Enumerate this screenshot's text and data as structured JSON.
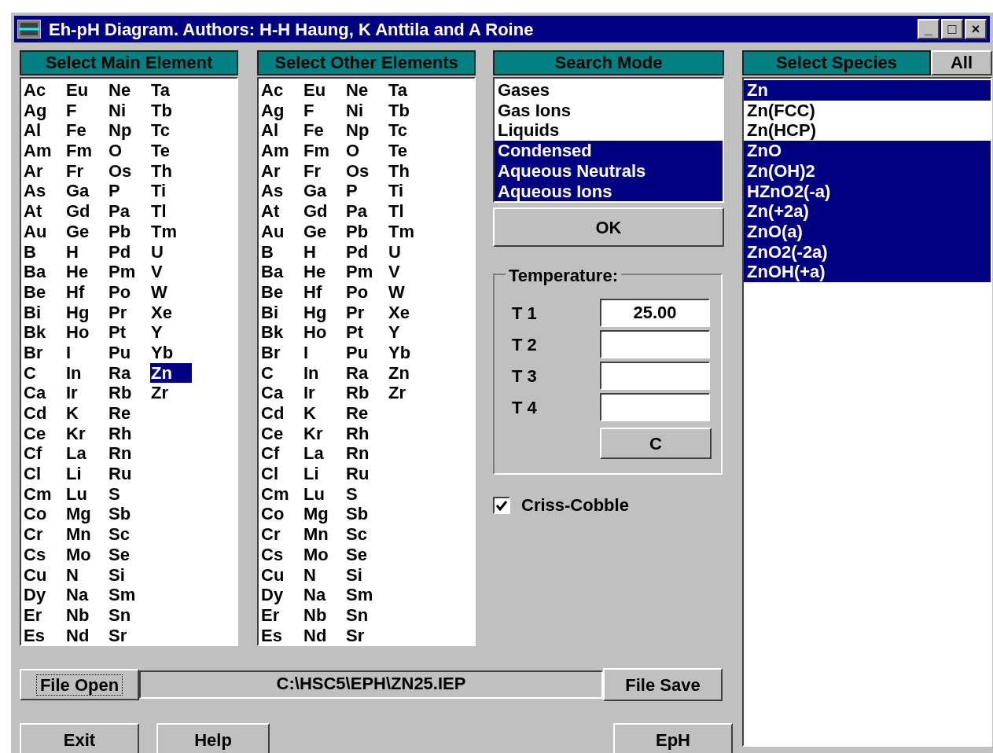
{
  "window": {
    "title": "Eh-pH Diagram. Authors: H-H Haung, K Anttila and A Roine",
    "controls": [
      "_",
      "□",
      "×"
    ]
  },
  "main_element": {
    "title": "Select Main Element",
    "items": [
      {
        "label": "Ac",
        "selected": false
      },
      {
        "label": "Ag",
        "selected": false
      },
      {
        "label": "Al",
        "selected": false
      },
      {
        "label": "Am",
        "selected": false
      },
      {
        "label": "Ar",
        "selected": false
      },
      {
        "label": "As",
        "selected": false
      },
      {
        "label": "At",
        "selected": false
      },
      {
        "label": "Au",
        "selected": false
      },
      {
        "label": "B",
        "selected": false
      },
      {
        "label": "Ba",
        "selected": false
      },
      {
        "label": "Be",
        "selected": false
      },
      {
        "label": "Bi",
        "selected": false
      },
      {
        "label": "Bk",
        "selected": false
      },
      {
        "label": "Br",
        "selected": false
      },
      {
        "label": "C",
        "selected": false
      },
      {
        "label": "Ca",
        "selected": false
      },
      {
        "label": "Cd",
        "selected": false
      },
      {
        "label": "Ce",
        "selected": false
      },
      {
        "label": "Cf",
        "selected": false
      },
      {
        "label": "Cl",
        "selected": false
      },
      {
        "label": "Cm",
        "selected": false
      },
      {
        "label": "Co",
        "selected": false
      },
      {
        "label": "Cr",
        "selected": false
      },
      {
        "label": "Cs",
        "selected": false
      },
      {
        "label": "Cu",
        "selected": false
      },
      {
        "label": "Dy",
        "selected": false
      },
      {
        "label": "Er",
        "selected": false
      },
      {
        "label": "Es",
        "selected": false
      },
      {
        "label": "Eu",
        "selected": false
      },
      {
        "label": "F",
        "selected": false
      },
      {
        "label": "Fe",
        "selected": false
      },
      {
        "label": "Fm",
        "selected": false
      },
      {
        "label": "Fr",
        "selected": false
      },
      {
        "label": "Ga",
        "selected": false
      },
      {
        "label": "Gd",
        "selected": false
      },
      {
        "label": "Ge",
        "selected": false
      },
      {
        "label": "H",
        "selected": false
      },
      {
        "label": "He",
        "selected": false
      },
      {
        "label": "Hf",
        "selected": false
      },
      {
        "label": "Hg",
        "selected": false
      },
      {
        "label": "Ho",
        "selected": false
      },
      {
        "label": "I",
        "selected": false
      },
      {
        "label": "In",
        "selected": false
      },
      {
        "label": "Ir",
        "selected": false
      },
      {
        "label": "K",
        "selected": false
      },
      {
        "label": "Kr",
        "selected": false
      },
      {
        "label": "La",
        "selected": false
      },
      {
        "label": "Li",
        "selected": false
      },
      {
        "label": "Lu",
        "selected": false
      },
      {
        "label": "Mg",
        "selected": false
      },
      {
        "label": "Mn",
        "selected": false
      },
      {
        "label": "Mo",
        "selected": false
      },
      {
        "label": "N",
        "selected": false
      },
      {
        "label": "Na",
        "selected": false
      },
      {
        "label": "Nb",
        "selected": false
      },
      {
        "label": "Nd",
        "selected": false
      },
      {
        "label": "Ne",
        "selected": false
      },
      {
        "label": "Ni",
        "selected": false
      },
      {
        "label": "Np",
        "selected": false
      },
      {
        "label": "O",
        "selected": false
      },
      {
        "label": "Os",
        "selected": false
      },
      {
        "label": "P",
        "selected": false
      },
      {
        "label": "Pa",
        "selected": false
      },
      {
        "label": "Pb",
        "selected": false
      },
      {
        "label": "Pd",
        "selected": false
      },
      {
        "label": "Pm",
        "selected": false
      },
      {
        "label": "Po",
        "selected": false
      },
      {
        "label": "Pr",
        "selected": false
      },
      {
        "label": "Pt",
        "selected": false
      },
      {
        "label": "Pu",
        "selected": false
      },
      {
        "label": "Ra",
        "selected": false
      },
      {
        "label": "Rb",
        "selected": false
      },
      {
        "label": "Re",
        "selected": false
      },
      {
        "label": "Rh",
        "selected": false
      },
      {
        "label": "Rn",
        "selected": false
      },
      {
        "label": "Ru",
        "selected": false
      },
      {
        "label": "S",
        "selected": false
      },
      {
        "label": "Sb",
        "selected": false
      },
      {
        "label": "Sc",
        "selected": false
      },
      {
        "label": "Se",
        "selected": false
      },
      {
        "label": "Si",
        "selected": false
      },
      {
        "label": "Sm",
        "selected": false
      },
      {
        "label": "Sn",
        "selected": false
      },
      {
        "label": "Sr",
        "selected": false
      },
      {
        "label": "Ta",
        "selected": false
      },
      {
        "label": "Tb",
        "selected": false
      },
      {
        "label": "Tc",
        "selected": false
      },
      {
        "label": "Te",
        "selected": false
      },
      {
        "label": "Th",
        "selected": false
      },
      {
        "label": "Ti",
        "selected": false
      },
      {
        "label": "Tl",
        "selected": false
      },
      {
        "label": "Tm",
        "selected": false
      },
      {
        "label": "U",
        "selected": false
      },
      {
        "label": "V",
        "selected": false
      },
      {
        "label": "W",
        "selected": false
      },
      {
        "label": "Xe",
        "selected": false
      },
      {
        "label": "Y",
        "selected": false
      },
      {
        "label": "Yb",
        "selected": false
      },
      {
        "label": "Zn",
        "selected": true
      },
      {
        "label": "Zr",
        "selected": false
      }
    ]
  },
  "other_elements": {
    "title": "Select Other Elements",
    "items": [
      {
        "label": "Ac",
        "selected": false
      },
      {
        "label": "Ag",
        "selected": false
      },
      {
        "label": "Al",
        "selected": false
      },
      {
        "label": "Am",
        "selected": false
      },
      {
        "label": "Ar",
        "selected": false
      },
      {
        "label": "As",
        "selected": false
      },
      {
        "label": "At",
        "selected": false
      },
      {
        "label": "Au",
        "selected": false
      },
      {
        "label": "B",
        "selected": false
      },
      {
        "label": "Ba",
        "selected": false
      },
      {
        "label": "Be",
        "selected": false
      },
      {
        "label": "Bi",
        "selected": false
      },
      {
        "label": "Bk",
        "selected": false
      },
      {
        "label": "Br",
        "selected": false
      },
      {
        "label": "C",
        "selected": false
      },
      {
        "label": "Ca",
        "selected": false
      },
      {
        "label": "Cd",
        "selected": false
      },
      {
        "label": "Ce",
        "selected": false
      },
      {
        "label": "Cf",
        "selected": false
      },
      {
        "label": "Cl",
        "selected": false
      },
      {
        "label": "Cm",
        "selected": false
      },
      {
        "label": "Co",
        "selected": false
      },
      {
        "label": "Cr",
        "selected": false
      },
      {
        "label": "Cs",
        "selected": false
      },
      {
        "label": "Cu",
        "selected": false
      },
      {
        "label": "Dy",
        "selected": false
      },
      {
        "label": "Er",
        "selected": false
      },
      {
        "label": "Es",
        "selected": false
      },
      {
        "label": "Eu",
        "selected": false
      },
      {
        "label": "F",
        "selected": false
      },
      {
        "label": "Fe",
        "selected": false
      },
      {
        "label": "Fm",
        "selected": false
      },
      {
        "label": "Fr",
        "selected": false
      },
      {
        "label": "Ga",
        "selected": false
      },
      {
        "label": "Gd",
        "selected": false
      },
      {
        "label": "Ge",
        "selected": false
      },
      {
        "label": "H",
        "selected": false
      },
      {
        "label": "He",
        "selected": false
      },
      {
        "label": "Hf",
        "selected": false
      },
      {
        "label": "Hg",
        "selected": false
      },
      {
        "label": "Ho",
        "selected": false
      },
      {
        "label": "I",
        "selected": false
      },
      {
        "label": "In",
        "selected": false
      },
      {
        "label": "Ir",
        "selected": false
      },
      {
        "label": "K",
        "selected": false
      },
      {
        "label": "Kr",
        "selected": false
      },
      {
        "label": "La",
        "selected": false
      },
      {
        "label": "Li",
        "selected": false
      },
      {
        "label": "Lu",
        "selected": false
      },
      {
        "label": "Mg",
        "selected": false
      },
      {
        "label": "Mn",
        "selected": false
      },
      {
        "label": "Mo",
        "selected": false
      },
      {
        "label": "N",
        "selected": false
      },
      {
        "label": "Na",
        "selected": false
      },
      {
        "label": "Nb",
        "selected": false
      },
      {
        "label": "Nd",
        "selected": false
      },
      {
        "label": "Ne",
        "selected": false
      },
      {
        "label": "Ni",
        "selected": false
      },
      {
        "label": "Np",
        "selected": false
      },
      {
        "label": "O",
        "selected": false
      },
      {
        "label": "Os",
        "selected": false
      },
      {
        "label": "P",
        "selected": false
      },
      {
        "label": "Pa",
        "selected": false
      },
      {
        "label": "Pb",
        "selected": false
      },
      {
        "label": "Pd",
        "selected": false
      },
      {
        "label": "Pm",
        "selected": false
      },
      {
        "label": "Po",
        "selected": false
      },
      {
        "label": "Pr",
        "selected": false
      },
      {
        "label": "Pt",
        "selected": false
      },
      {
        "label": "Pu",
        "selected": false
      },
      {
        "label": "Ra",
        "selected": false
      },
      {
        "label": "Rb",
        "selected": false
      },
      {
        "label": "Re",
        "selected": false
      },
      {
        "label": "Rh",
        "selected": false
      },
      {
        "label": "Rn",
        "selected": false
      },
      {
        "label": "Ru",
        "selected": false
      },
      {
        "label": "S",
        "selected": false
      },
      {
        "label": "Sb",
        "selected": false
      },
      {
        "label": "Sc",
        "selected": false
      },
      {
        "label": "Se",
        "selected": false
      },
      {
        "label": "Si",
        "selected": false
      },
      {
        "label": "Sm",
        "selected": false
      },
      {
        "label": "Sn",
        "selected": false
      },
      {
        "label": "Sr",
        "selected": false
      },
      {
        "label": "Ta",
        "selected": false
      },
      {
        "label": "Tb",
        "selected": false
      },
      {
        "label": "Tc",
        "selected": false
      },
      {
        "label": "Te",
        "selected": false
      },
      {
        "label": "Th",
        "selected": false
      },
      {
        "label": "Ti",
        "selected": false
      },
      {
        "label": "Tl",
        "selected": false
      },
      {
        "label": "Tm",
        "selected": false
      },
      {
        "label": "U",
        "selected": false
      },
      {
        "label": "V",
        "selected": false
      },
      {
        "label": "W",
        "selected": false
      },
      {
        "label": "Xe",
        "selected": false
      },
      {
        "label": "Y",
        "selected": false
      },
      {
        "label": "Yb",
        "selected": false
      },
      {
        "label": "Zn",
        "selected": false
      },
      {
        "label": "Zr",
        "selected": false
      }
    ]
  },
  "search_mode": {
    "title": "Search Mode",
    "items": [
      {
        "label": "Gases",
        "selected": false
      },
      {
        "label": "Gas Ions",
        "selected": false
      },
      {
        "label": "Liquids",
        "selected": false
      },
      {
        "label": "Condensed",
        "selected": true
      },
      {
        "label": "Aqueous Neutrals",
        "selected": true
      },
      {
        "label": "Aqueous Ions",
        "selected": true
      }
    ],
    "ok_button": "OK"
  },
  "temperature": {
    "title": "Temperature:",
    "fields": [
      {
        "label": "T 1",
        "value": "25.00"
      },
      {
        "label": "T 2"
      },
      {
        "label": "T 3"
      },
      {
        "label": "T 4"
      }
    ],
    "clear_button": "C"
  },
  "criss_cobble": {
    "label": "Criss-Cobble",
    "checked": true
  },
  "species": {
    "title": "Select Species",
    "all_button": "All",
    "items": [
      {
        "label": "Zn",
        "selected": true
      },
      {
        "label": "Zn(FCC)",
        "selected": false
      },
      {
        "label": "Zn(HCP)",
        "selected": false
      },
      {
        "label": "ZnO",
        "selected": true
      },
      {
        "label": "Zn(OH)2",
        "selected": true
      },
      {
        "label": "HZnO2(-a)",
        "selected": true
      },
      {
        "label": "Zn(+2a)",
        "selected": true
      },
      {
        "label": "ZnO(a)",
        "selected": true
      },
      {
        "label": "ZnO2(-2a)",
        "selected": true
      },
      {
        "label": "ZnOH(+a)",
        "selected": true
      }
    ]
  },
  "file": {
    "open_button": "File Open",
    "path": "C:\\HSC5\\EPH\\ZN25.IEP",
    "save_button": "File Save"
  },
  "buttons": [
    "Exit",
    "Help",
    "EpH"
  ]
}
